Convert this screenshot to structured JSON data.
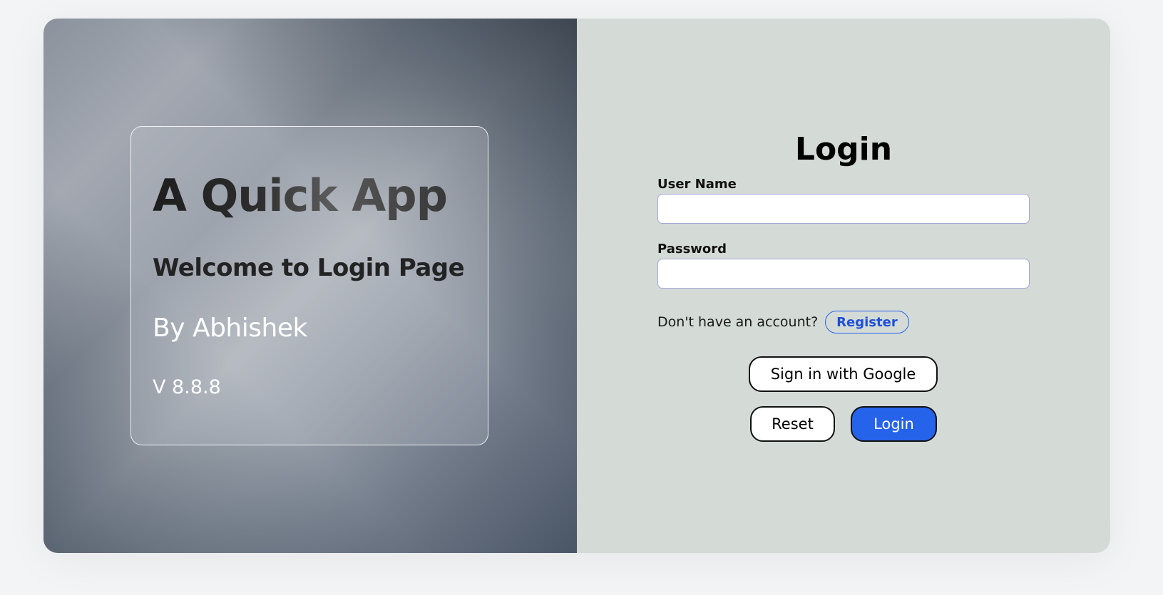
{
  "hero": {
    "app_title": "A Quick App",
    "welcome": "Welcome to Login Page",
    "author": "By Abhishek",
    "version": "V 8.8.8"
  },
  "form": {
    "title": "Login",
    "username_label": "User Name",
    "username_value": "",
    "password_label": "Password",
    "password_value": "",
    "register_prompt": "Don't have an account?",
    "register_label": "Register",
    "google_label": "Sign in with Google",
    "reset_label": "Reset",
    "login_label": "Login"
  },
  "colors": {
    "accent": "#2563eb",
    "form_background": "#d4dad6",
    "page_background": "#f3f4f6"
  }
}
